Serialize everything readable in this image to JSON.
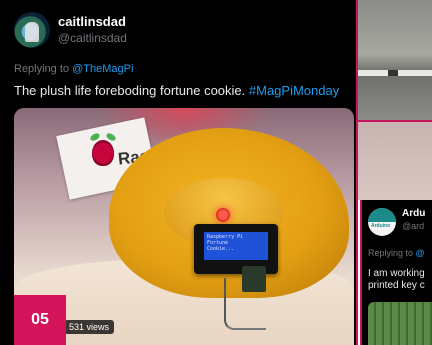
{
  "tweet": {
    "display_name": "caitlinsdad",
    "handle": "@caitlinsdad",
    "replying_prefix": "Replying to",
    "replying_to": "@TheMagPi",
    "text": "The plush life foreboding fortune cookie.",
    "hashtag": "#MagPiMonday",
    "views": "531 views",
    "card_text": "Ras",
    "lcd_lines": [
      "Raspberry Pi",
      "Fortune",
      "Cookie..."
    ]
  },
  "badge": "05",
  "tweet2": {
    "display_name": "Ardu",
    "handle": "@ard",
    "avatar_label": "Arduino",
    "replying_prefix": "Replying to",
    "replying_to": "@",
    "text_line1": "I am working",
    "text_line2": "printed key c"
  },
  "colors": {
    "accent_border": "#c2185b",
    "badge_bg": "#d4145a",
    "link": "#1d9bf0"
  }
}
